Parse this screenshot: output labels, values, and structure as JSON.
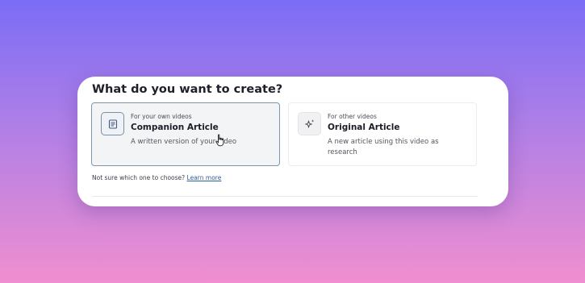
{
  "dialog": {
    "title": "What do you want to create?",
    "options": [
      {
        "eyebrow": "For your own videos",
        "title": "Companion Article",
        "description": "A written version of your video",
        "icon": "document-icon",
        "selected": true
      },
      {
        "eyebrow": "For other videos",
        "title": "Original Article",
        "description": "A new article using this video as research",
        "icon": "sparkle-icon",
        "selected": false
      }
    ],
    "help_text": "Not sure which one to choose?",
    "help_link": "Learn more"
  },
  "colors": {
    "background_top": "#7b6cf6",
    "background_bottom": "#f08fcf",
    "selected_border": "#7c96ae",
    "link": "#2b5c9c"
  }
}
